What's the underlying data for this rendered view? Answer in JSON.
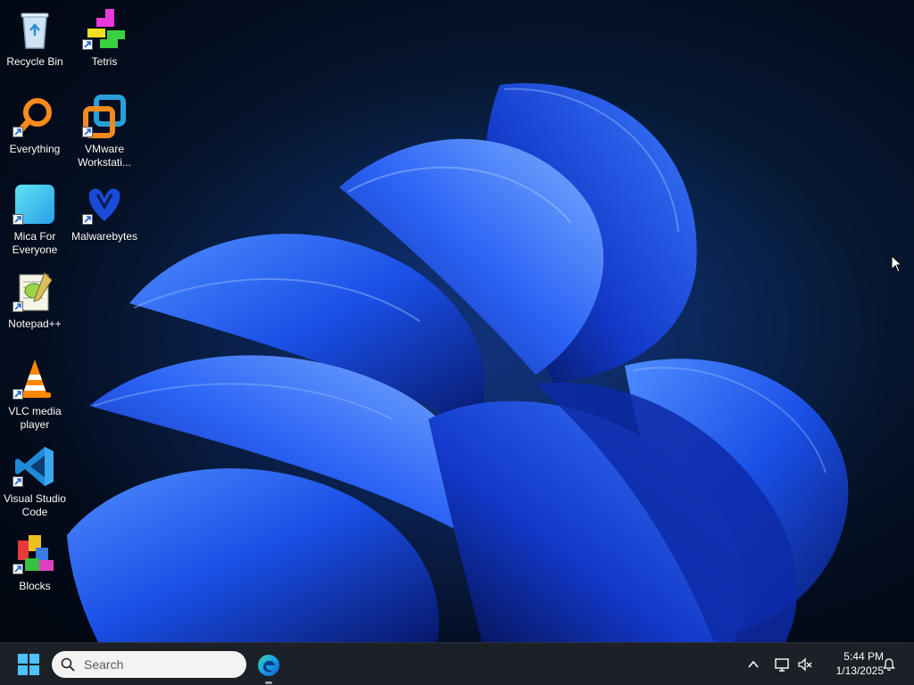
{
  "desktop": {
    "icons": [
      {
        "label": "Recycle Bin",
        "icon": "recycle-bin-icon"
      },
      {
        "label": "Tetris",
        "icon": "tetris-icon"
      },
      {
        "label": "Everything",
        "icon": "everything-search-icon"
      },
      {
        "label": "VMware Workstati...",
        "icon": "vmware-icon"
      },
      {
        "label": "Mica For Everyone",
        "icon": "mica-icon"
      },
      {
        "label": "Malwarebytes",
        "icon": "malwarebytes-icon"
      },
      {
        "label": "Notepad++",
        "icon": "notepad-plus-plus-icon"
      },
      {
        "label": "VLC media player",
        "icon": "vlc-icon"
      },
      {
        "label": "Visual Studio Code",
        "icon": "vscode-icon"
      },
      {
        "label": "Blocks",
        "icon": "blocks-icon"
      }
    ]
  },
  "taskbar": {
    "search": {
      "placeholder": "Search"
    },
    "pinned": [
      {
        "name": "Microsoft Edge",
        "icon": "edge-icon"
      }
    ],
    "tray": {
      "time": "5:44 PM",
      "date": "1/13/2025"
    }
  },
  "colors": {
    "taskbar_bg": "#1c2128",
    "accent": "#1f6fff",
    "desktop_bg": "#061832"
  }
}
